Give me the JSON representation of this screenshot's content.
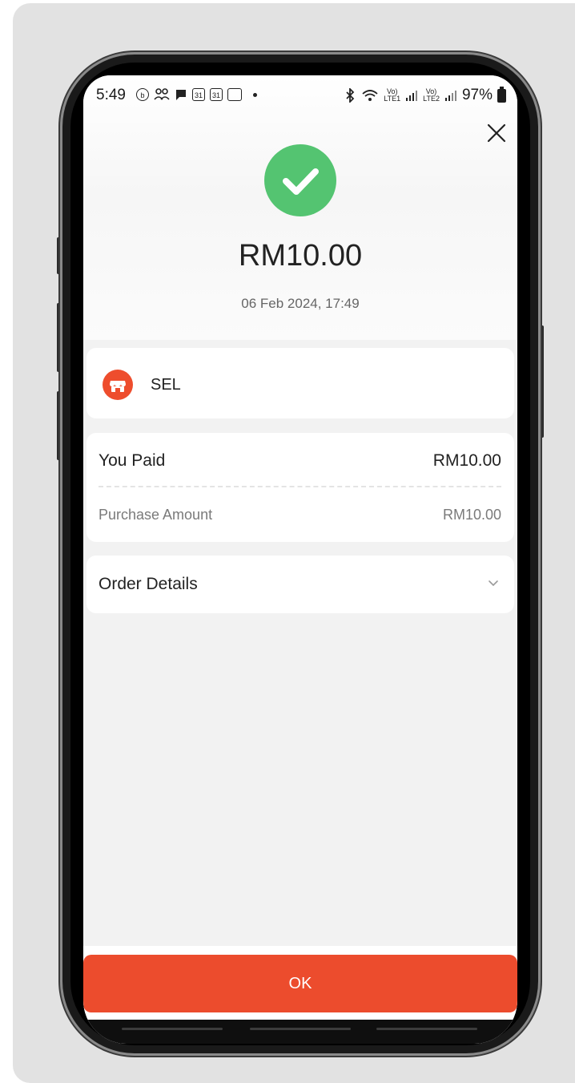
{
  "status_bar": {
    "time": "5:49",
    "battery": "97%",
    "left_icons": [
      "b-icon",
      "people-icon",
      "message-icon",
      "calendar-icon",
      "calendar-icon",
      "touch-n-go-icon"
    ],
    "right_icons": [
      "bluetooth-icon",
      "wifi-icon",
      "volte1-signal-icon",
      "volte2-signal-icon",
      "battery-icon"
    ],
    "cal_day": "31",
    "lte1": "LTE1",
    "lte2": "LTE2"
  },
  "receipt": {
    "amount": "RM10.00",
    "datetime": "06 Feb 2024, 17:49"
  },
  "merchant": {
    "name": "SEL"
  },
  "payment": {
    "you_paid_label": "You Paid",
    "you_paid_value": "RM10.00",
    "purchase_amount_label": "Purchase Amount",
    "purchase_amount_value": "RM10.00"
  },
  "order": {
    "label": "Order Details"
  },
  "actions": {
    "ok_label": "OK"
  },
  "colors": {
    "success": "#54c471",
    "primary": "#ec4c2d"
  }
}
